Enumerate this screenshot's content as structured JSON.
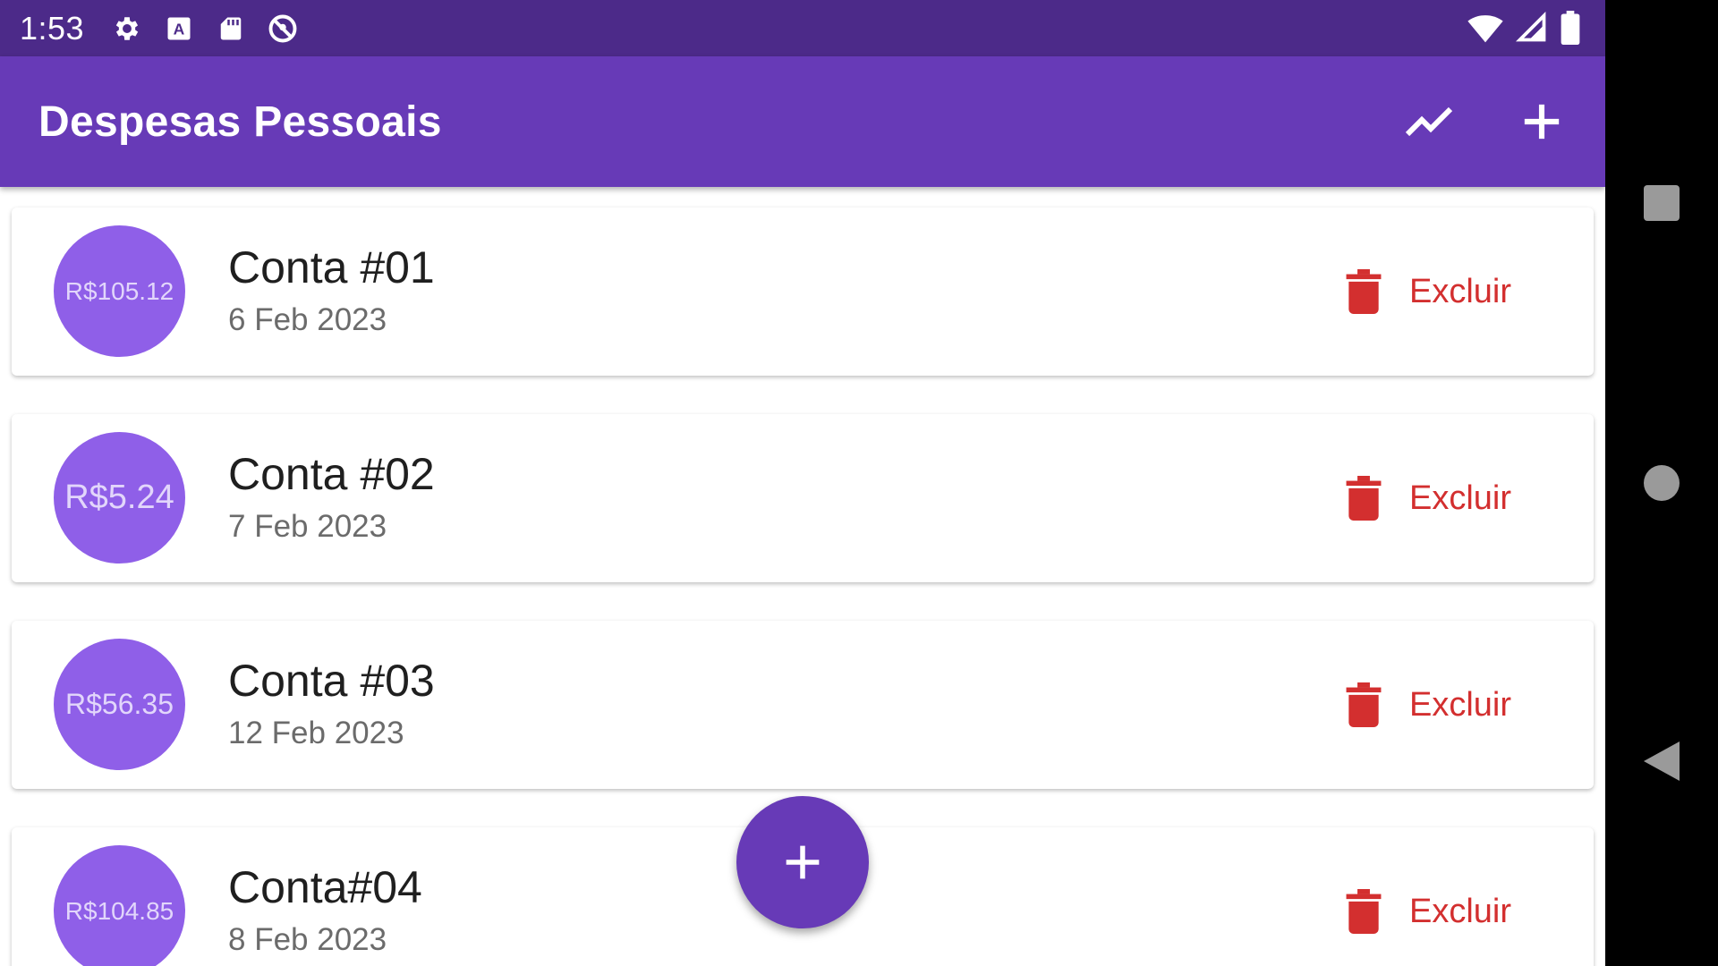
{
  "status_bar": {
    "time": "1:53",
    "left_icons": [
      "gear-icon",
      "text-a-icon",
      "sd-card-icon",
      "no-location-icon"
    ],
    "right_icons": [
      "wifi-icon",
      "cell-signal-icon",
      "battery-icon"
    ]
  },
  "app_bar": {
    "title": "Despesas Pessoais",
    "actions": [
      "chart-line-icon",
      "add-icon"
    ]
  },
  "expenses": [
    {
      "amount": "R$105.12",
      "title": "Conta #01",
      "date": "6 Feb 2023",
      "delete_label": "Excluir"
    },
    {
      "amount": "R$5.24",
      "title": "Conta #02",
      "date": "7 Feb 2023",
      "delete_label": "Excluir"
    },
    {
      "amount": "R$56.35",
      "title": "Conta #03",
      "date": "12 Feb 2023",
      "delete_label": "Excluir"
    },
    {
      "amount": "R$104.85",
      "title": "Conta#04",
      "date": "8 Feb 2023",
      "delete_label": "Excluir"
    }
  ],
  "fab": {
    "icon": "add-icon"
  },
  "nav_bar": {
    "buttons": [
      "recents-icon",
      "home-icon",
      "back-icon"
    ]
  },
  "colors": {
    "status_bar": "#4c2a89",
    "primary": "#673ab7",
    "avatar": "#8f5fe8",
    "delete": "#d32f2f"
  }
}
